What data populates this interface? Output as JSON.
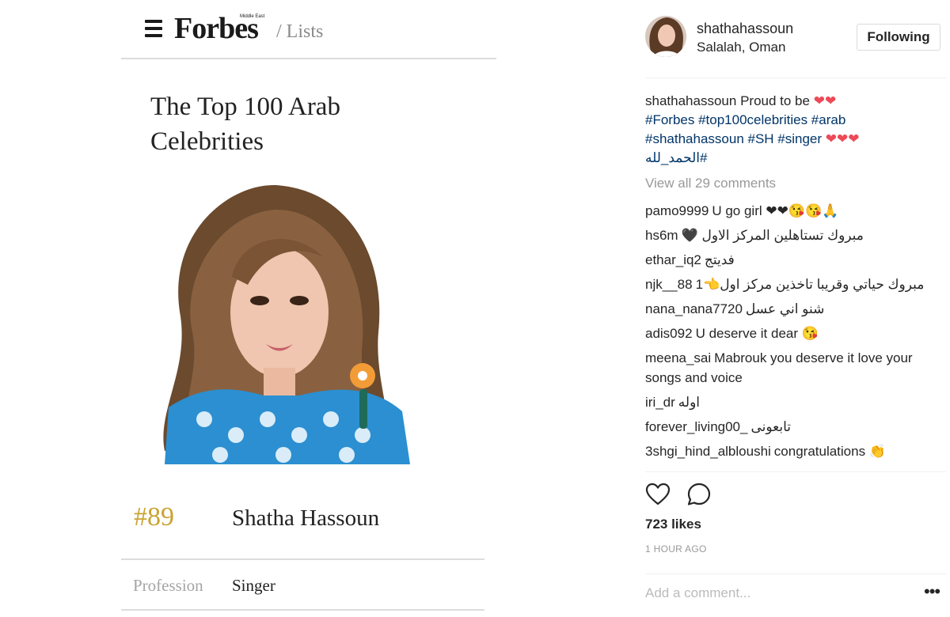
{
  "forbes": {
    "logo": "Forbes",
    "edition": "Middle East",
    "section": "/ Lists",
    "list_title": "The Top 100 Arab Celebrities",
    "rank": "#89",
    "name": "Shatha Hassoun",
    "profession_label": "Profession",
    "profession_value": "Singer"
  },
  "instagram": {
    "username": "shathahassoun",
    "location": "Salalah, Oman",
    "follow_label": "Following",
    "caption": {
      "user": "shathahassoun",
      "text": "Proud to be",
      "hearts_1": "❤❤",
      "hashtags": "#Forbes #top100celebrities #arab #shathahassoun #SH #singer",
      "hearts_2": "❤❤❤",
      "hashtag_arabic": "#الحمد_لله"
    },
    "view_all": "View all 29 comments",
    "comments": [
      {
        "user": "pamo9999",
        "text": "U go girl ❤❤😘😘🙏"
      },
      {
        "user": "hs6m",
        "text": "مبروك تستاهلين المركز الاول 🖤"
      },
      {
        "user": "ethar_iq2",
        "text": "فديتج"
      },
      {
        "user": "njk__88",
        "text": "مبروك حياتي وقريبا تاخذين مركز اول👈1"
      },
      {
        "user": "nana_nana7720",
        "text": "شنو اني عسل"
      },
      {
        "user": "adis092",
        "text": "U deserve it dear 😘"
      },
      {
        "user": "meena_sai",
        "text": "Mabrouk you deserve it love your songs and voice"
      },
      {
        "user": "iri_dr",
        "text": "اوله"
      },
      {
        "user": "forever_living00_",
        "text": "تابعونى"
      },
      {
        "user": "3shgi_hind_albloushi",
        "text": "congratulations 👏"
      }
    ],
    "likes": "723 likes",
    "time": "1 HOUR AGO",
    "add_comment_placeholder": "Add a comment...",
    "more_label": "•••",
    "icons": {
      "like": "heart-outline-icon",
      "comment": "speech-bubble-icon",
      "more": "ellipsis-icon"
    },
    "colors": {
      "hashtag": "#003569",
      "heart": "#ed4956",
      "muted": "#999999"
    }
  }
}
